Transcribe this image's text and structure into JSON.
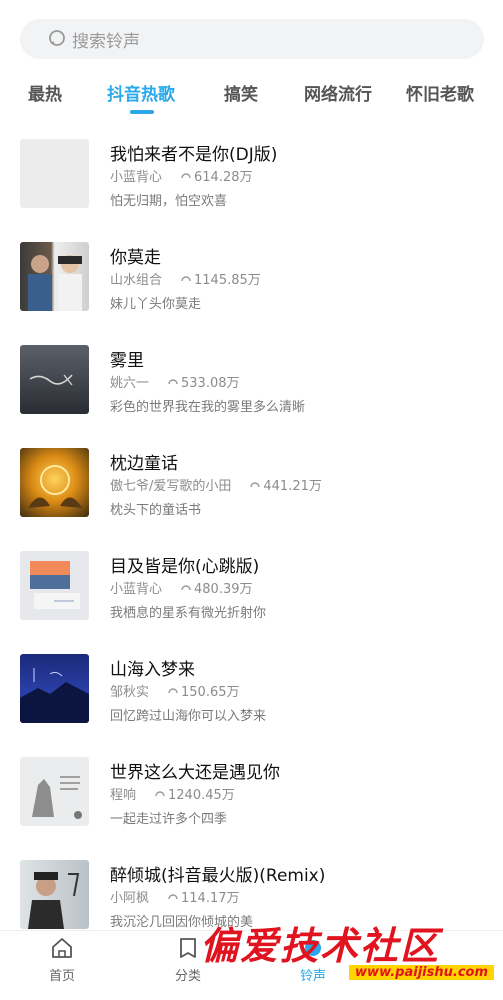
{
  "search": {
    "placeholder": "搜索铃声",
    "icon": "search-icon"
  },
  "tabs": [
    {
      "label": "最热",
      "active": false
    },
    {
      "label": "抖音热歌",
      "active": true
    },
    {
      "label": "搞笑",
      "active": false
    },
    {
      "label": "网络流行",
      "active": false
    },
    {
      "label": "怀旧老歌",
      "active": false
    }
  ],
  "songs": [
    {
      "title": "我怕来者不是你(DJ版)",
      "artist": "小蓝背心",
      "plays": "614.28万",
      "desc": "怕无归期，怕空欢喜"
    },
    {
      "title": "你莫走",
      "artist": "山水组合",
      "plays": "1145.85万",
      "desc": "妹儿丫头你莫走"
    },
    {
      "title": "雾里",
      "artist": "姚六一",
      "plays": "533.08万",
      "desc": "彩色的世界我在我的雾里多么清晰"
    },
    {
      "title": "枕边童话",
      "artist": "傲七爷/爱写歌的小田",
      "plays": "441.21万",
      "desc": "枕头下的童话书"
    },
    {
      "title": "目及皆是你(心跳版)",
      "artist": "小蓝背心",
      "plays": "480.39万",
      "desc": "我栖息的星系有微光折射你"
    },
    {
      "title": "山海入梦来",
      "artist": "邹秋实",
      "plays": "150.65万",
      "desc": "回忆跨过山海你可以入梦来"
    },
    {
      "title": "世界这么大还是遇见你",
      "artist": "程响",
      "plays": "1240.45万",
      "desc": "一起走过许多个四季"
    },
    {
      "title": "醉倾城(抖音最火版)(Remix)",
      "artist": "小阿枫",
      "plays": "114.17万",
      "desc": "我沉沦几回因你倾城的美"
    }
  ],
  "bottom_nav": [
    {
      "label": "首页",
      "icon": "home-icon",
      "active": false
    },
    {
      "label": "分类",
      "icon": "category-icon",
      "active": false
    },
    {
      "label": "铃声",
      "icon": "ringtone-icon",
      "active": true
    }
  ],
  "watermark": {
    "text": "偏爱技术社区",
    "url": "www.paijishu.com"
  },
  "colors": {
    "accent": "#2aa8ea",
    "watermark": "#e0131f"
  }
}
